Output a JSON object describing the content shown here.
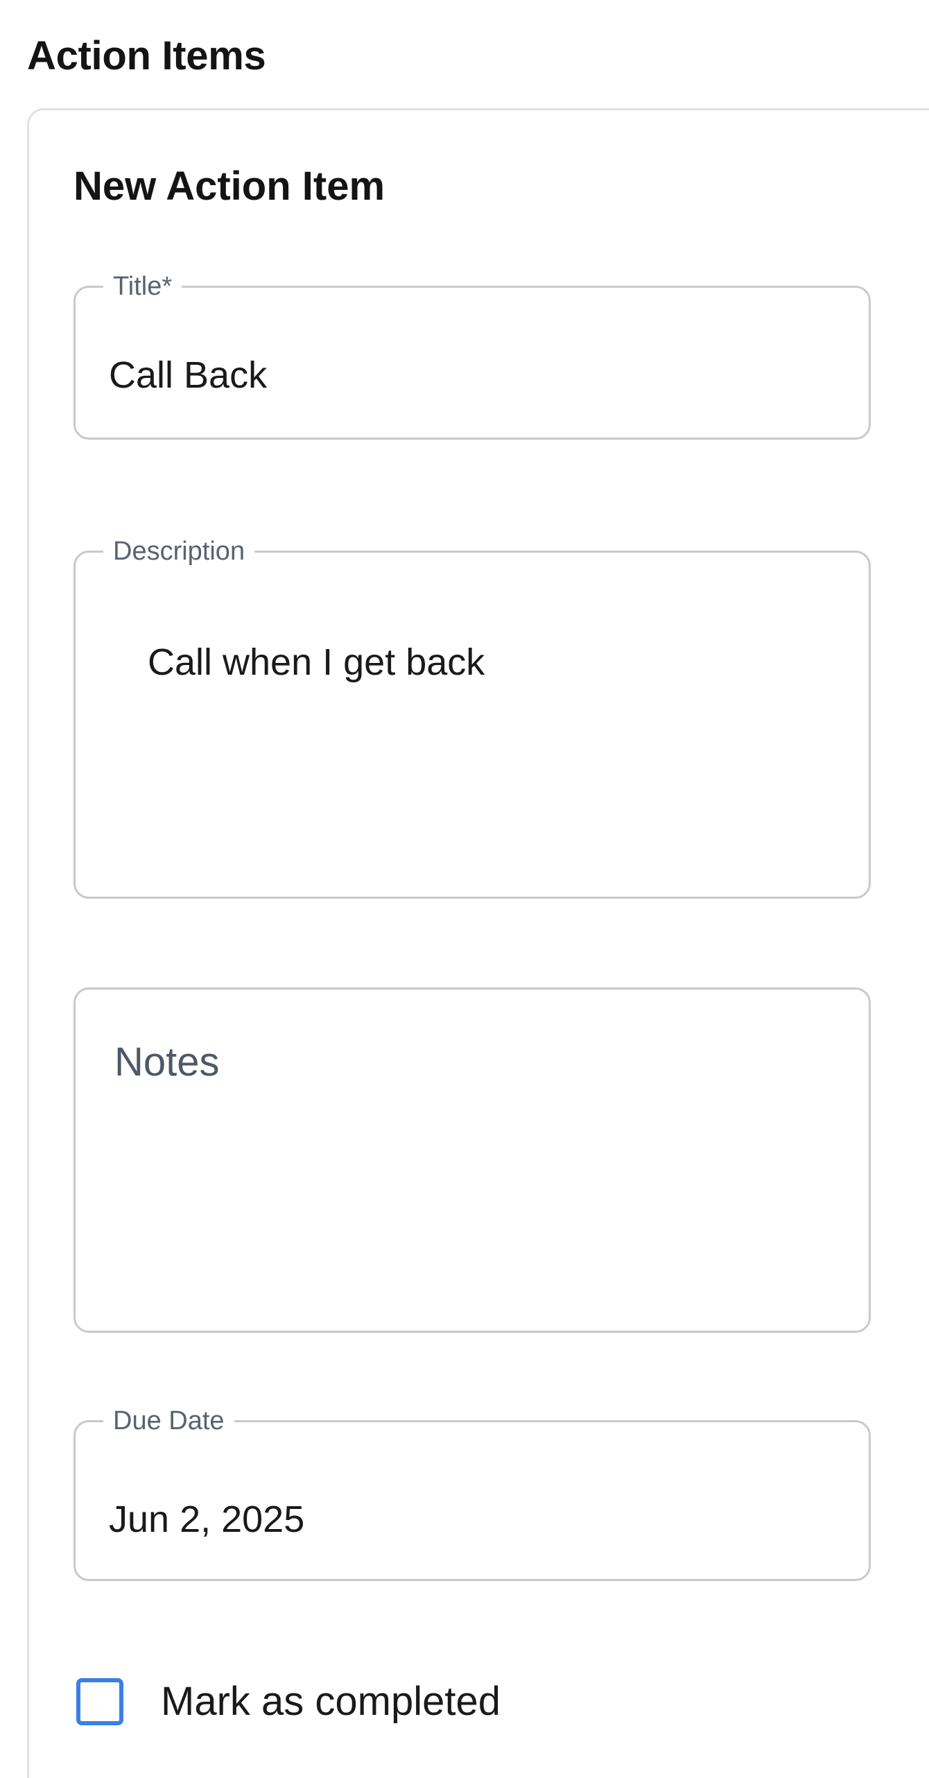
{
  "section": {
    "title": "Action Items"
  },
  "form": {
    "heading": "New Action Item",
    "title_field": {
      "label": "Title*",
      "value": "Call Back"
    },
    "description_field": {
      "label": "Description",
      "value": "Call when I get back"
    },
    "notes_field": {
      "placeholder": "Notes",
      "value": ""
    },
    "due_date_field": {
      "label": "Due Date",
      "value": "Jun 2, 2025",
      "focused": true
    },
    "completed_checkbox": {
      "label": "Mark as completed",
      "checked": false
    }
  },
  "colors": {
    "focus_border": "#4a9fe6",
    "checkbox_border": "#3b7fe6",
    "field_border": "#c9c9c9",
    "label_text": "#5a6270"
  }
}
